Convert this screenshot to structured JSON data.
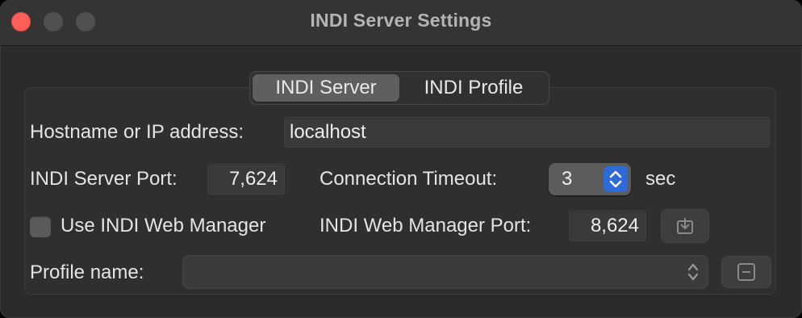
{
  "window": {
    "title": "INDI Server Settings"
  },
  "tabs": {
    "server": "INDI Server",
    "profile": "INDI Profile"
  },
  "form": {
    "hostname_label": "Hostname or IP address:",
    "hostname_value": "localhost",
    "port_label": "INDI Server Port:",
    "port_value": "7,624",
    "timeout_label": "Connection Timeout:",
    "timeout_value": "3",
    "timeout_unit": "sec",
    "web_manager_label": "Use INDI Web Manager",
    "web_manager_checked": false,
    "web_manager_port_label": "INDI Web Manager Port:",
    "web_manager_port_value": "8,624",
    "profile_label": "Profile name:",
    "profile_value": ""
  },
  "icons": {
    "fetch": "download-icon",
    "remove": "minus-icon",
    "stepper": "chevron-up-down-icon",
    "popup": "chevron-up-down-icon"
  },
  "colors": {
    "close": "#fe5f57",
    "accent": "#2f6bd8"
  }
}
